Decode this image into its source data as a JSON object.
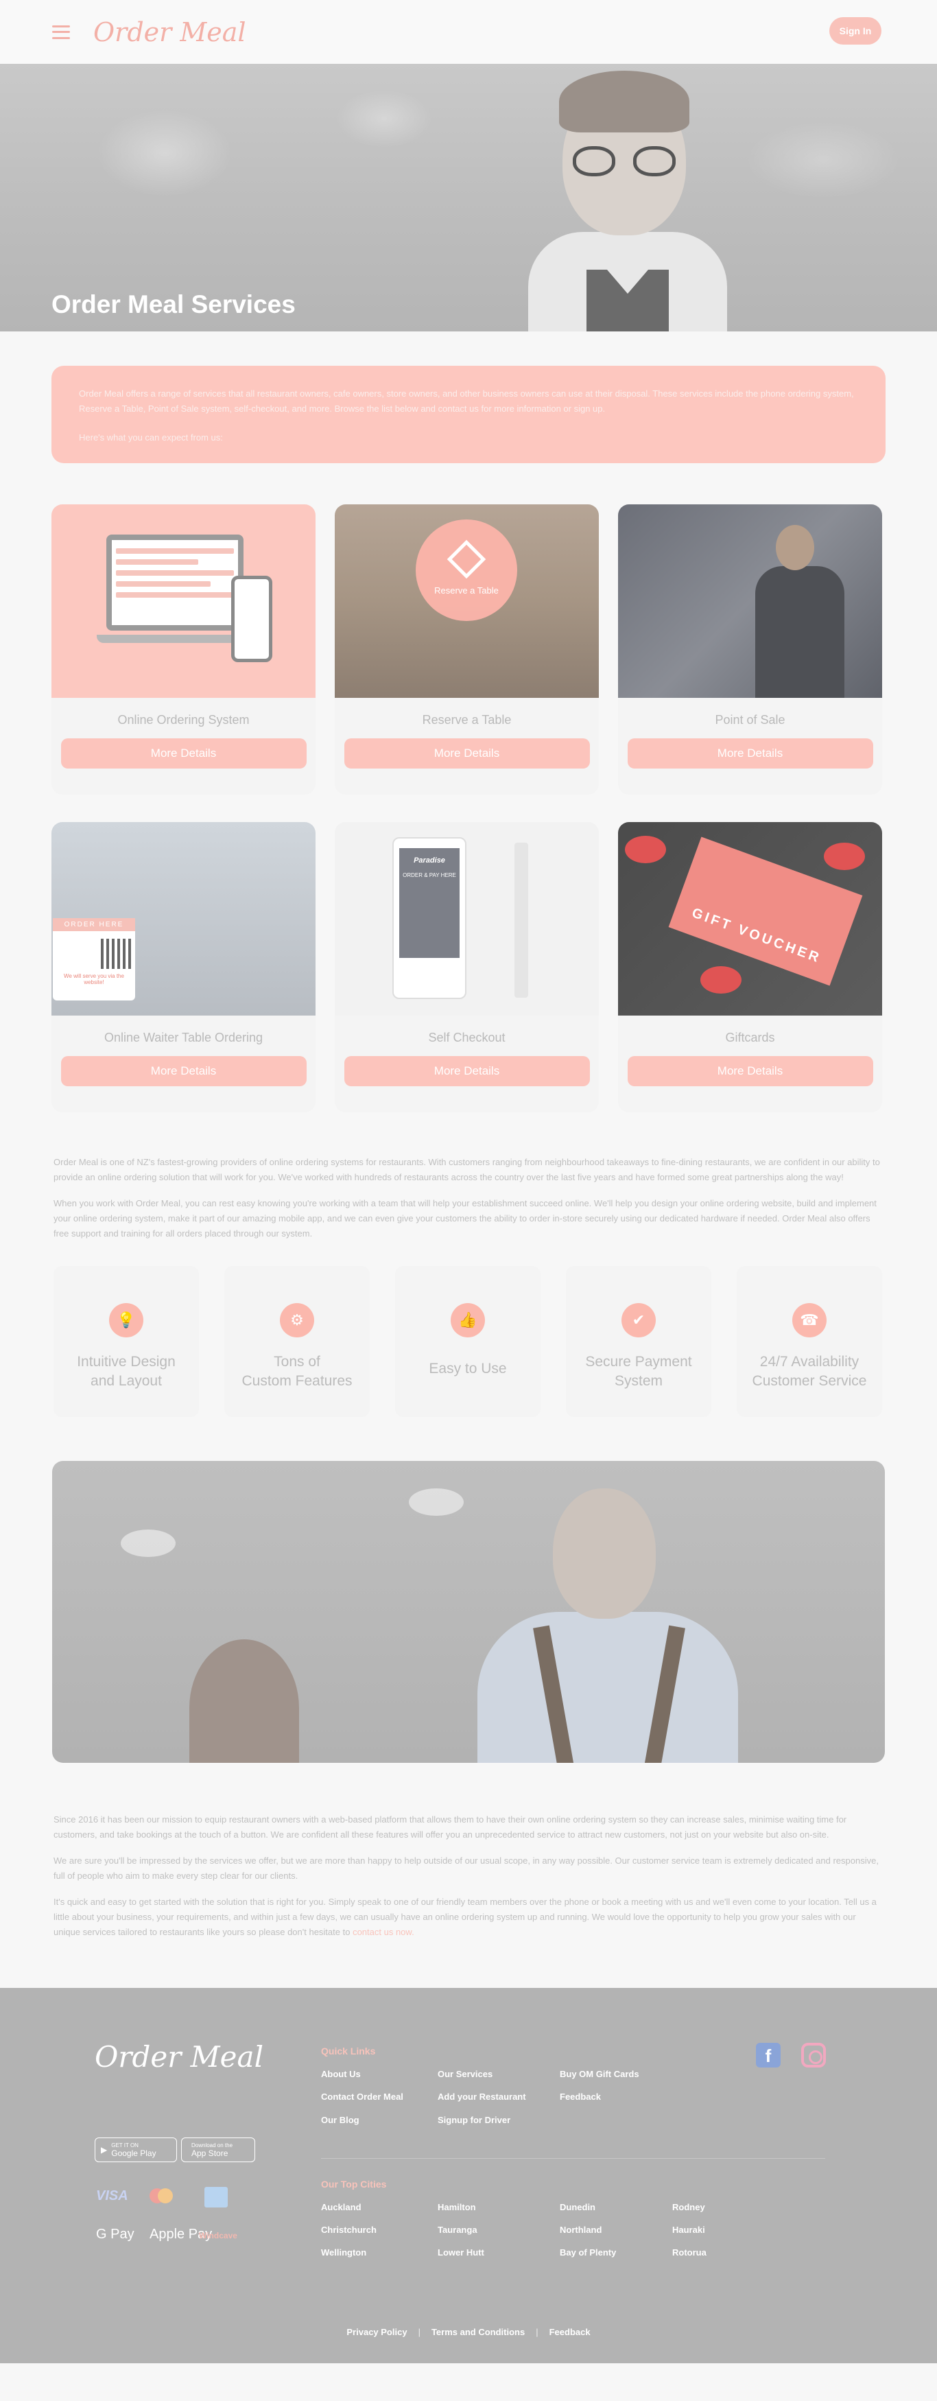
{
  "header": {
    "logo_text": "Order Meal",
    "signin_label": "Sign In",
    "accent": "#f3b0a7"
  },
  "hero": {
    "title": "Order Meal Services"
  },
  "intro": {
    "p1": "Order Meal offers a range of services that all restaurant owners, cafe owners, store owners, and other business owners can use at their disposal. These services include the phone ordering system, Reserve a Table, Point of Sale system, self-checkout, and more. Browse the list below and contact us for more information or sign up.",
    "p2": "Here's what you can expect from us:"
  },
  "services": {
    "button_label": "More Details",
    "items": [
      {
        "title": "Online Ordering System"
      },
      {
        "title": "Reserve a Table",
        "badge": "Reserve a Table"
      },
      {
        "title": "Point of Sale"
      },
      {
        "title": "Online Waiter Table Ordering",
        "badge": "ORDER HERE",
        "badge_sub": "We will serve you via the website!"
      },
      {
        "title": "Self Checkout",
        "kiosk_text": "Paradise",
        "kiosk_sub": "ORDER & PAY HERE"
      },
      {
        "title": "Giftcards",
        "badge": "GIFT VOUCHER"
      }
    ]
  },
  "about": {
    "p1": "Order Meal is one of NZ's fastest-growing providers of online ordering systems for restaurants. With customers ranging from neighbourhood takeaways to fine-dining restaurants, we are confident in our ability to provide an online ordering solution that will work for you. We've worked with hundreds of restaurants across the country over the last five years and have formed some great partnerships along the way!",
    "p2": "When you work with Order Meal, you can rest easy knowing you're working with a team that will help your establishment succeed online. We'll help you design your online ordering website, build and implement your online ordering system, make it part of our amazing mobile app, and we can even give your customers the ability to order in-store securely using our dedicated hardware if needed. Order Meal also offers free support and training for all orders placed through our system."
  },
  "features": [
    {
      "icon": "lightbulb-icon",
      "glyph": "💡",
      "line1": "Intuitive Design",
      "line2": "and Layout"
    },
    {
      "icon": "gear-icon",
      "glyph": "⚙",
      "line1": "Tons of",
      "line2": "Custom Features"
    },
    {
      "icon": "thumbs-up-icon",
      "glyph": "👍",
      "line1": "Easy to Use",
      "line2": ""
    },
    {
      "icon": "shield-check-icon",
      "glyph": "✔",
      "line1": "Secure Payment",
      "line2": "System"
    },
    {
      "icon": "headset-icon",
      "glyph": "☎",
      "line1": "24/7 Availability",
      "line2": "Customer Service"
    }
  ],
  "closing": {
    "p1": "Since 2016 it has been our mission to equip restaurant owners with a web-based platform that allows them to have their own online ordering system so they can increase sales, minimise waiting time for customers, and take bookings at the touch of a button. We are confident all these features will offer you an unprecedented service to attract new customers, not just on your website but also on-site.",
    "p2": "We are sure you'll be impressed by the services we offer, but we are more than happy to help outside of our usual scope, in any way possible. Our customer service team is extremely dedicated and responsive, full of people who aim to make every step clear for our clients.",
    "p3": "It's quick and easy to get started with the solution that is right for you. Simply speak to one of our friendly team members over the phone or book a meeting with us and we'll even come to your location. Tell us a little about your business, your requirements, and within just a few days, we can usually have an online ordering system up and running. We would love the opportunity to help you grow your sales with our unique services tailored to restaurants like yours so please don't hesitate to",
    "link": "contact us now."
  },
  "footer": {
    "logo_text": "Order Meal",
    "google_small": "GET IT ON",
    "google_big": "Google Play",
    "apple_small": "Download on the",
    "apple_big": "App Store",
    "quick_links_title": "Quick Links",
    "quick_links": [
      "About Us",
      "Our Services",
      "Buy OM Gift Cards",
      "Contact Order Meal",
      "Add your Restaurant",
      "Feedback",
      "Our Blog",
      "Signup for Driver"
    ],
    "cities_title": "Our Top Cities",
    "cities": [
      "Auckland",
      "Hamilton",
      "Dunedin",
      "Rodney",
      "Christchurch",
      "Tauranga",
      "Northland",
      "Hauraki",
      "Wellington",
      "Lower Hutt",
      "Bay of Plenty",
      "Rotorua"
    ],
    "payments": [
      "VISA",
      "Mastercard",
      "AMEX",
      "G Pay",
      "Apple Pay",
      "Windcave"
    ],
    "bottom": [
      "Privacy Policy",
      "Terms and Conditions",
      "Feedback"
    ]
  }
}
